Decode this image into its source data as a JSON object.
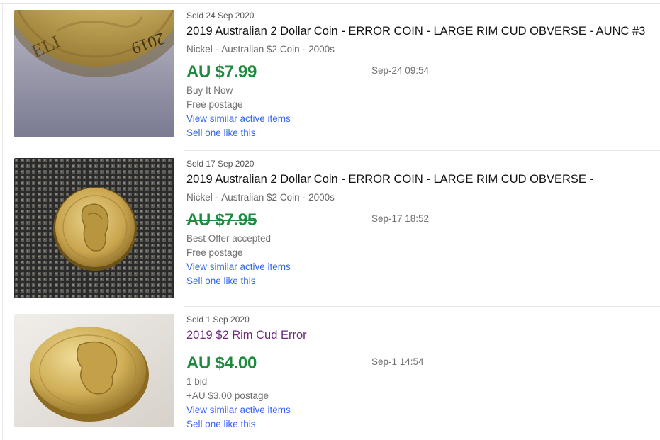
{
  "listings": [
    {
      "sold_date": "Sold 24 Sep 2020",
      "title": "2019 Australian 2 Dollar Coin - ERROR COIN - LARGE RIM CUD OBVERSE - AUNC #3",
      "subtitle": [
        "Nickel",
        "Australian $2 Coin",
        "2000s"
      ],
      "price": "AU $7.99",
      "end_date": "Sep-24 09:54",
      "format": "Buy It Now",
      "shipping": "Free postage",
      "similar_link": "View similar active items",
      "sell_link": "Sell one like this",
      "coin_text_a": "ELI",
      "coin_text_b": "2019"
    },
    {
      "sold_date": "Sold 17 Sep 2020",
      "title": "2019 Australian 2 Dollar Coin - ERROR COIN - LARGE RIM CUD OBVERSE -",
      "subtitle": [
        "Nickel",
        "Australian $2 Coin",
        "2000s"
      ],
      "price": "AU $7.95",
      "end_date": "Sep-17 18:52",
      "format": "Best Offer accepted",
      "shipping": "Free postage",
      "similar_link": "View similar active items",
      "sell_link": "Sell one like this"
    },
    {
      "sold_date": "Sold 1 Sep 2020",
      "title": "2019 $2 Rim Cud Error",
      "price": "AU $4.00",
      "end_date": "Sep-1 14:54",
      "format": "1 bid",
      "shipping": "+AU $3.00 postage",
      "similar_link": "View similar active items",
      "sell_link": "Sell one like this"
    }
  ],
  "colors": {
    "price_green": "#1f8a3d",
    "link_blue": "#3665f3",
    "visited_purple": "#6b2a7a"
  }
}
